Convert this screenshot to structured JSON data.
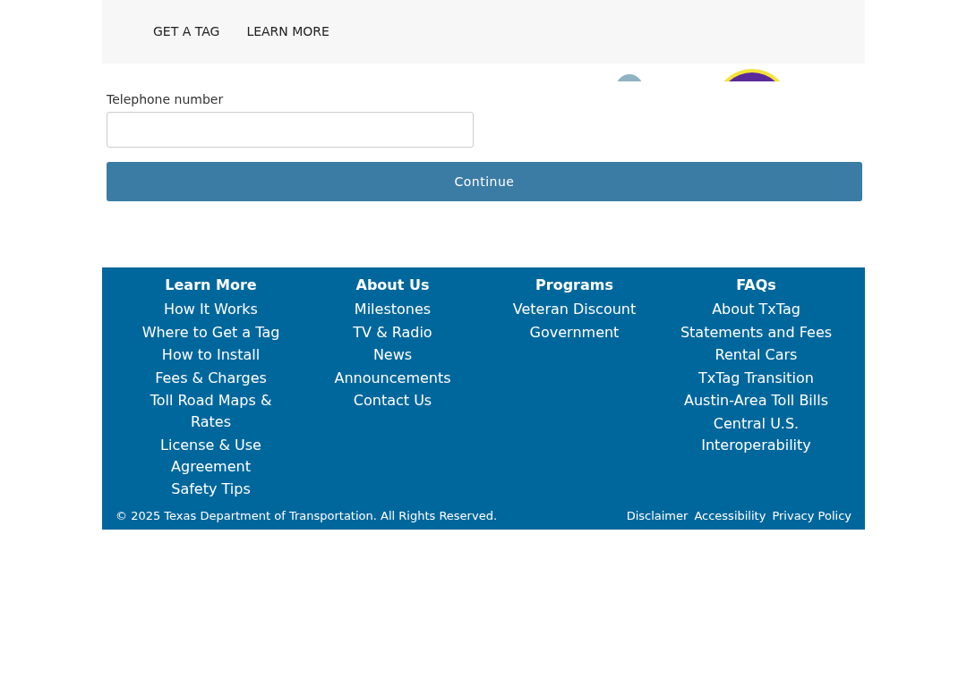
{
  "nav": {
    "links": [
      "GET A TAG",
      "LEARN MORE"
    ]
  },
  "form": {
    "label": "Telephone number",
    "button": "Continue"
  },
  "footer": {
    "columns": [
      {
        "title": "Learn More",
        "links": [
          "How It Works",
          "Where to Get a Tag",
          "How to Install",
          "Fees & Charges",
          "Toll Road Maps & Rates",
          "License & Use Agreement",
          "Safety Tips"
        ]
      },
      {
        "title": "About Us",
        "links": [
          "Milestones",
          "TV & Radio",
          "News",
          "Announcements",
          "Contact Us"
        ]
      },
      {
        "title": "Programs",
        "links": [
          "Veteran Discount",
          "Government"
        ]
      },
      {
        "title": "FAQs",
        "links": [
          "About TxTag",
          "Statements and Fees",
          "Rental Cars",
          "TxTag Transition",
          "Austin-Area Toll Bills",
          "Central U.S. Interoperability"
        ]
      }
    ],
    "copyright": "© 2025 Texas Department of Transportation. All Rights Reserved.",
    "legal_links": [
      "Disclaimer",
      "Accessibility",
      "Privacy Policy"
    ]
  }
}
